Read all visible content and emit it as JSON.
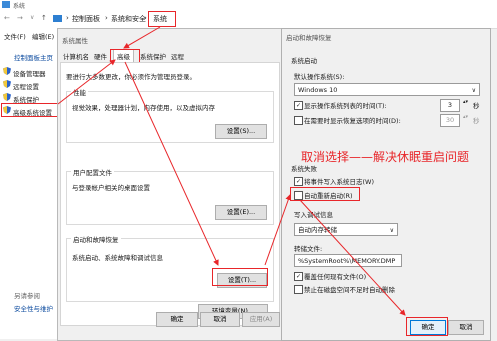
{
  "window": {
    "title": "系统"
  },
  "breadcrumb": {
    "item1": "控制面板",
    "item2": "系统和安全",
    "item3": "系统"
  },
  "menu": {
    "file": "文件(F)",
    "edit": "编辑(E)"
  },
  "left_pane": {
    "home": "控制面板主页",
    "items": [
      "设备管理器",
      "远程设置",
      "系统保护",
      "高级系统设置"
    ],
    "see_also": "另请参阅",
    "security": "安全性与维护"
  },
  "sysprop": {
    "title": "系统属性",
    "tabs": [
      "计算机名",
      "硬件",
      "高级",
      "系统保护",
      "远程"
    ],
    "admin_note": "要进行大多数更改，你必须作为管理员登录。",
    "performance": {
      "title": "性能",
      "desc": "视觉效果，处理器计划，内存使用，以及虚拟内存",
      "button": "设置(S)..."
    },
    "profiles": {
      "title": "用户配置文件",
      "desc": "与登录帐户相关的桌面设置",
      "button": "设置(E)..."
    },
    "startup": {
      "title": "启动和故障恢复",
      "desc": "系统启动、系统故障和调试信息",
      "button": "设置(T)..."
    },
    "env_button": "环境变量(N)...",
    "ok": "确定",
    "cancel": "取消",
    "apply": "应用(A)"
  },
  "recovery": {
    "title": "启动和故障恢复",
    "startup_group": "系统启动",
    "default_os_label": "默认操作系统(S):",
    "default_os": "Windows 10",
    "show_list_label": "显示操作系统列表的时间(T):",
    "show_list_value": "3",
    "show_recovery_label": "在需要时显示恢复选项的时间(D):",
    "show_recovery_value": "30",
    "seconds": "秒",
    "failure_group": "系统失败",
    "write_event": "将事件写入系统日志(W)",
    "auto_restart": "自动重新启动(R)",
    "debug_group": "写入调试信息",
    "debug_type": "自动内存转储",
    "dump_file_label": "转储文件:",
    "dump_file": "%SystemRoot%\\MEMORY.DMP",
    "overwrite": "覆盖任何现有文件(O)",
    "disable_auto_delete": "禁止在磁盘空间不足时自动删除",
    "ok": "确定",
    "cancel": "取消"
  },
  "annotation": {
    "text": "取消选择——解决休眠重启问题"
  },
  "colors": {
    "highlight_red": "#e8262a",
    "annotation_red": "#e8262a",
    "selected_blue": "#cce8ff"
  }
}
